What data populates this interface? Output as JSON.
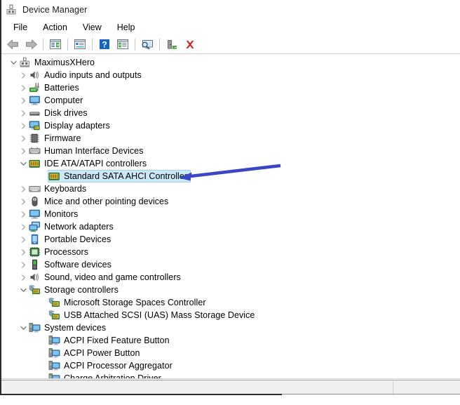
{
  "window": {
    "title": "Device Manager",
    "title_icon": "device-manager-icon"
  },
  "menu": {
    "items": [
      {
        "label": "File",
        "name": "menu-file"
      },
      {
        "label": "Action",
        "name": "menu-action"
      },
      {
        "label": "View",
        "name": "menu-view"
      },
      {
        "label": "Help",
        "name": "menu-help"
      }
    ]
  },
  "toolbar": {
    "buttons": [
      {
        "name": "back-button",
        "icon": "back-arrow-icon",
        "tooltip": "Back"
      },
      {
        "name": "forward-button",
        "icon": "forward-arrow-icon",
        "tooltip": "Forward"
      },
      {
        "name": "separator-1",
        "icon": "separator"
      },
      {
        "name": "show-hide-console-tree-button",
        "icon": "console-tree-icon",
        "tooltip": "Show/Hide Console Tree"
      },
      {
        "name": "separator-2",
        "icon": "separator"
      },
      {
        "name": "properties-button",
        "icon": "properties-icon",
        "tooltip": "Properties"
      },
      {
        "name": "separator-3",
        "icon": "separator"
      },
      {
        "name": "help-button",
        "icon": "help-question-icon",
        "tooltip": "Help"
      },
      {
        "name": "action-menu-button",
        "icon": "action-list-icon",
        "tooltip": "Action"
      },
      {
        "name": "separator-4",
        "icon": "separator"
      },
      {
        "name": "scan-for-hardware-changes-button",
        "icon": "scan-monitor-magnifier-icon",
        "tooltip": "Scan for hardware changes"
      },
      {
        "name": "separator-5",
        "icon": "separator"
      },
      {
        "name": "update-driver-button",
        "icon": "add-hardware-green-icon",
        "tooltip": "Update Driver Software"
      },
      {
        "name": "uninstall-device-button",
        "icon": "red-x-icon",
        "tooltip": "Uninstall device"
      }
    ]
  },
  "tree": {
    "nodes": [
      {
        "label": "MaximusXHero",
        "level": 0,
        "icon": "computer-root-icon",
        "expander": "expanded",
        "selected": false
      },
      {
        "label": "Audio inputs and outputs",
        "level": 1,
        "icon": "speaker-icon",
        "expander": "collapsed",
        "selected": false
      },
      {
        "label": "Batteries",
        "level": 1,
        "icon": "battery-icon",
        "expander": "collapsed",
        "selected": false
      },
      {
        "label": "Computer",
        "level": 1,
        "icon": "monitor-icon",
        "expander": "collapsed",
        "selected": false
      },
      {
        "label": "Disk drives",
        "level": 1,
        "icon": "disk-drive-icon",
        "expander": "collapsed",
        "selected": false
      },
      {
        "label": "Display adapters",
        "level": 1,
        "icon": "display-adapter-icon",
        "expander": "collapsed",
        "selected": false
      },
      {
        "label": "Firmware",
        "level": 1,
        "icon": "firmware-chip-icon",
        "expander": "collapsed",
        "selected": false
      },
      {
        "label": "Human Interface Devices",
        "level": 1,
        "icon": "hid-keyboard-icon",
        "expander": "collapsed",
        "selected": false
      },
      {
        "label": "IDE ATA/ATAPI controllers",
        "level": 1,
        "icon": "ide-controller-icon",
        "expander": "expanded",
        "selected": false
      },
      {
        "label": "Standard SATA AHCI Controller",
        "level": 2,
        "icon": "ide-controller-icon",
        "expander": "none",
        "selected": true
      },
      {
        "label": "Keyboards",
        "level": 1,
        "icon": "keyboard-icon",
        "expander": "collapsed",
        "selected": false
      },
      {
        "label": "Mice and other pointing devices",
        "level": 1,
        "icon": "mouse-icon",
        "expander": "collapsed",
        "selected": false
      },
      {
        "label": "Monitors",
        "level": 1,
        "icon": "monitor-icon",
        "expander": "collapsed",
        "selected": false
      },
      {
        "label": "Network adapters",
        "level": 1,
        "icon": "network-adapter-icon",
        "expander": "collapsed",
        "selected": false
      },
      {
        "label": "Portable Devices",
        "level": 1,
        "icon": "portable-device-icon",
        "expander": "collapsed",
        "selected": false
      },
      {
        "label": "Processors",
        "level": 1,
        "icon": "processor-icon",
        "expander": "collapsed",
        "selected": false
      },
      {
        "label": "Software devices",
        "level": 1,
        "icon": "software-device-icon",
        "expander": "collapsed",
        "selected": false
      },
      {
        "label": "Sound, video and game controllers",
        "level": 1,
        "icon": "speaker-icon",
        "expander": "collapsed",
        "selected": false
      },
      {
        "label": "Storage controllers",
        "level": 1,
        "icon": "storage-controller-icon",
        "expander": "expanded",
        "selected": false
      },
      {
        "label": "Microsoft Storage Spaces Controller",
        "level": 2,
        "icon": "storage-controller-icon",
        "expander": "none",
        "selected": false
      },
      {
        "label": "USB Attached SCSI (UAS) Mass Storage Device",
        "level": 2,
        "icon": "storage-controller-icon",
        "expander": "none",
        "selected": false
      },
      {
        "label": "System devices",
        "level": 1,
        "icon": "system-device-icon",
        "expander": "expanded",
        "selected": false
      },
      {
        "label": "ACPI Fixed Feature Button",
        "level": 2,
        "icon": "system-device-icon",
        "expander": "none",
        "selected": false
      },
      {
        "label": "ACPI Power Button",
        "level": 2,
        "icon": "system-device-icon",
        "expander": "none",
        "selected": false
      },
      {
        "label": "ACPI Processor Aggregator",
        "level": 2,
        "icon": "system-device-icon",
        "expander": "none",
        "selected": false
      },
      {
        "label": "Charge Arbitration Driver",
        "level": 2,
        "icon": "system-device-icon",
        "expander": "none",
        "selected": false
      }
    ]
  },
  "annotation": {
    "arrow_color": "#3b46c4",
    "arrow_name": "pointer-arrow-to-selected-device",
    "points_to": "Standard SATA AHCI Controller"
  },
  "statusbar": {
    "text": "",
    "secondary_text": ""
  },
  "colors": {
    "selection_fill": "#cce8f6",
    "selection_border": "#9fd3ea",
    "annotation": "#3b46c4",
    "chrome": "#f0f0f0"
  }
}
